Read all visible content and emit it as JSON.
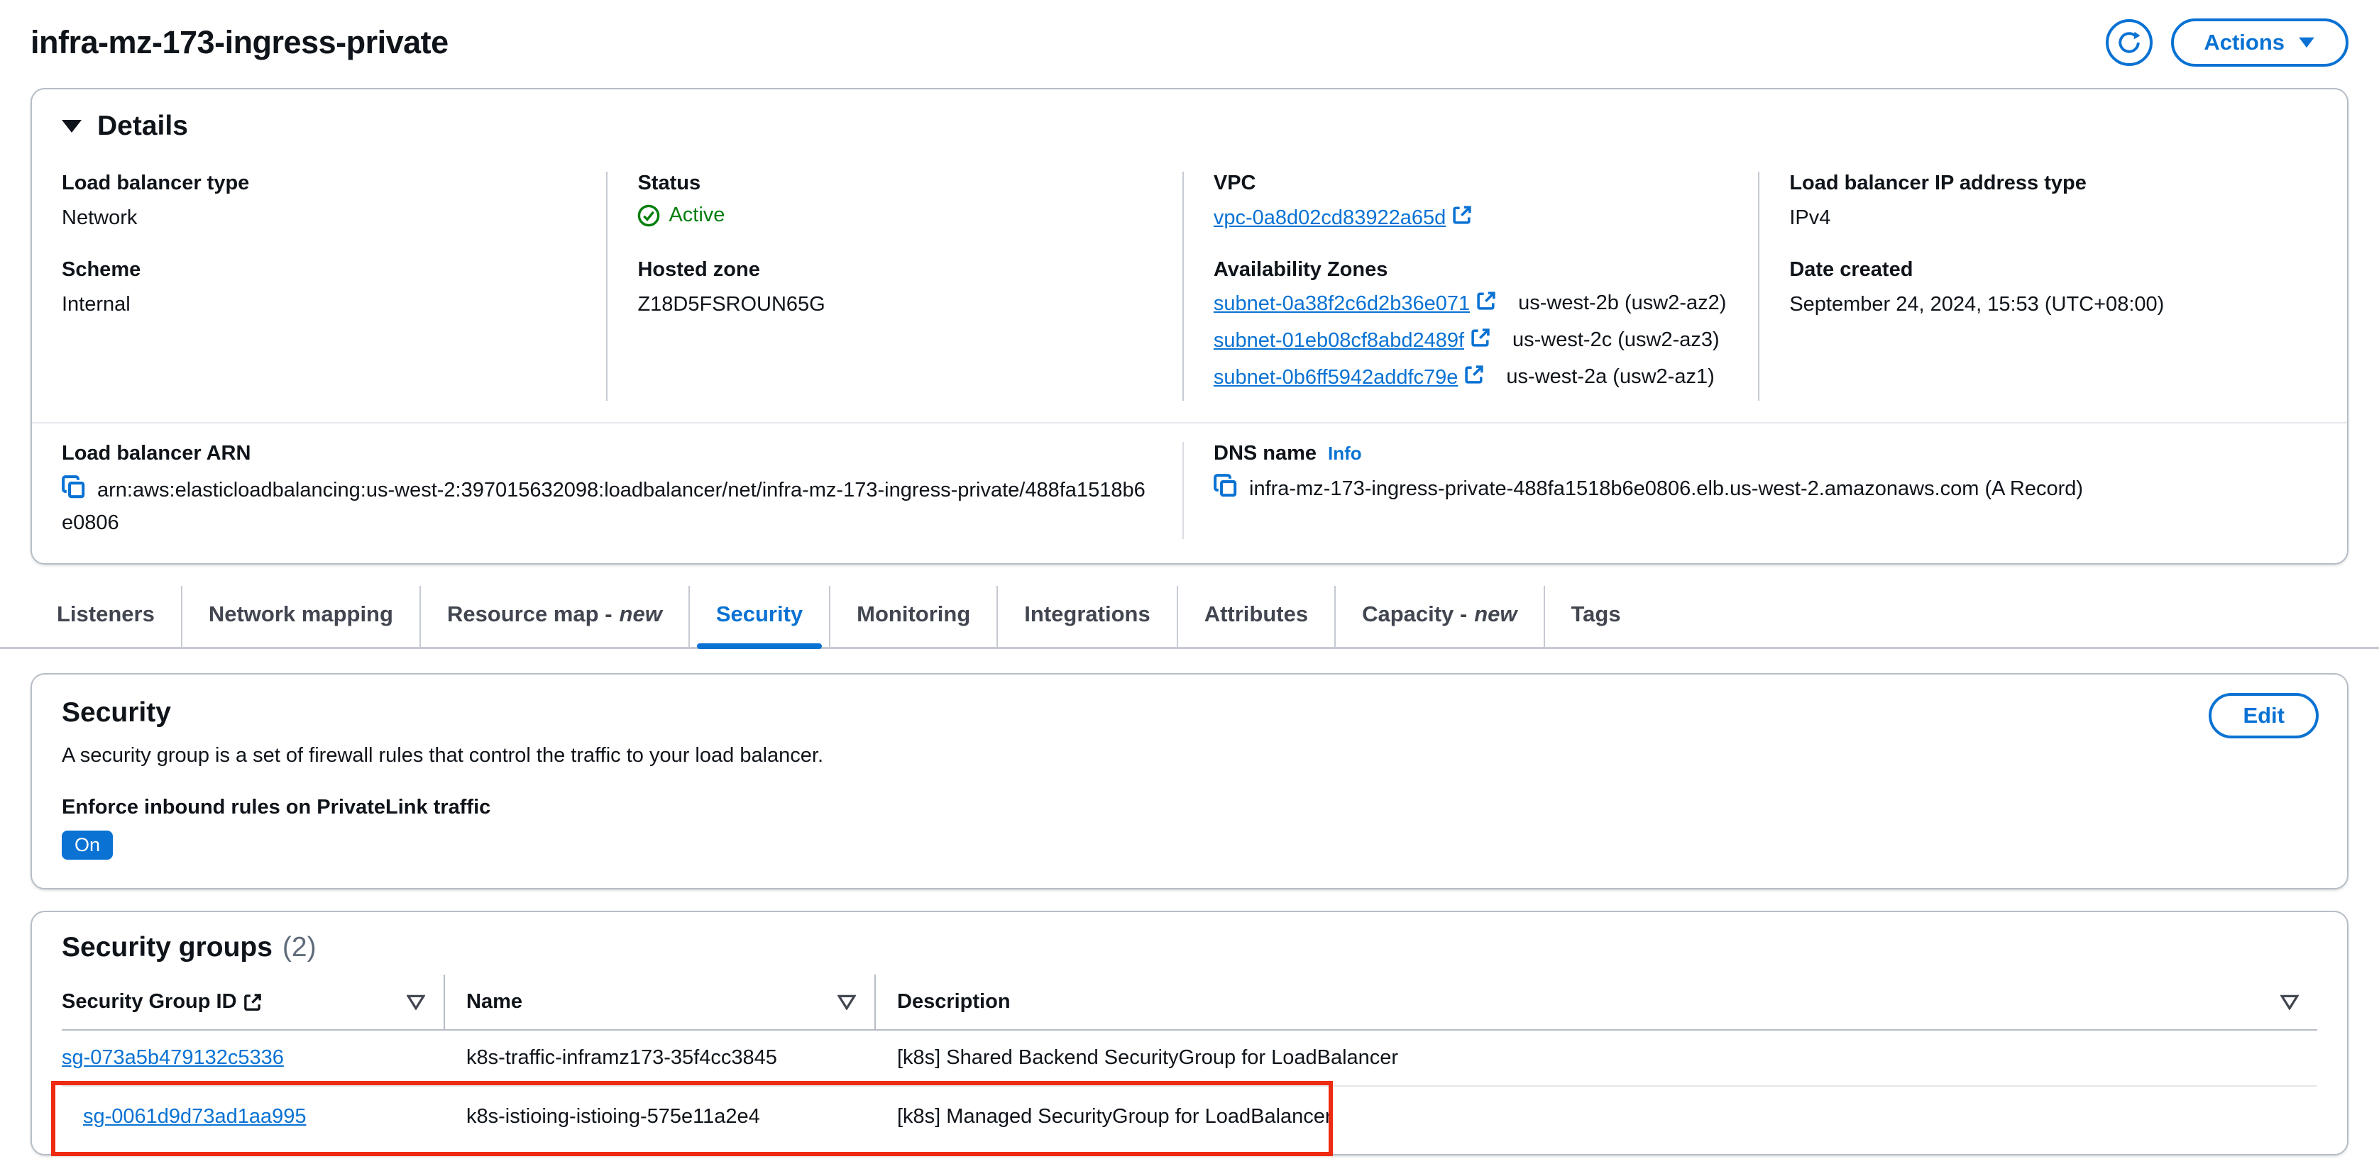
{
  "page": {
    "title": "infra-mz-173-ingress-private"
  },
  "header": {
    "actions_label": "Actions"
  },
  "colors": {
    "accent_blue": "#0972d3",
    "status_green": "#037f0c",
    "annotation_red": "#ee2b10",
    "badge_bg": "#0972d3"
  },
  "details": {
    "title": "Details",
    "load_balancer_type": {
      "label": "Load balancer type",
      "value": "Network"
    },
    "scheme": {
      "label": "Scheme",
      "value": "Internal"
    },
    "status": {
      "label": "Status",
      "value": "Active"
    },
    "hosted_zone": {
      "label": "Hosted zone",
      "value": "Z18D5FSROUN65G"
    },
    "vpc": {
      "label": "VPC",
      "link": "vpc-0a8d02cd83922a65d"
    },
    "availability_zones": {
      "label": "Availability Zones",
      "items": [
        {
          "subnet": "subnet-0a38f2c6d2b36e071",
          "zone": "us-west-2b (usw2-az2)"
        },
        {
          "subnet": "subnet-01eb08cf8abd2489f",
          "zone": "us-west-2c (usw2-az3)"
        },
        {
          "subnet": "subnet-0b6ff5942addfc79e",
          "zone": "us-west-2a (usw2-az1)"
        }
      ]
    },
    "ip_address_type": {
      "label": "Load balancer IP address type",
      "value": "IPv4"
    },
    "date_created": {
      "label": "Date created",
      "value": "September 24, 2024, 15:53 (UTC+08:00)"
    },
    "arn": {
      "label": "Load balancer ARN",
      "value": "arn:aws:elasticloadbalancing:us-west-2:397015632098:loadbalancer/net/infra-mz-173-ingress-private/488fa1518b6e0806"
    },
    "dns": {
      "label": "DNS name",
      "info_label": "Info",
      "value": "infra-mz-173-ingress-private-488fa1518b6e0806.elb.us-west-2.amazonaws.com (A Record)"
    }
  },
  "tabs": {
    "items": [
      {
        "label": "Listeners"
      },
      {
        "label": "Network mapping"
      },
      {
        "label": "Resource map -",
        "suffix": "new"
      },
      {
        "label": "Security"
      },
      {
        "label": "Monitoring"
      },
      {
        "label": "Integrations"
      },
      {
        "label": "Attributes"
      },
      {
        "label": "Capacity -",
        "suffix": "new"
      },
      {
        "label": "Tags"
      }
    ],
    "active": "Security"
  },
  "security": {
    "title": "Security",
    "edit_label": "Edit",
    "description": "A security group is a set of firewall rules that control the traffic to your load balancer.",
    "privatelink_label": "Enforce inbound rules on PrivateLink traffic",
    "privatelink_value": "On"
  },
  "security_groups": {
    "title": "Security groups",
    "count": "(2)",
    "columns": [
      {
        "label": "Security Group ID"
      },
      {
        "label": "Name"
      },
      {
        "label": "Description"
      }
    ],
    "rows": [
      {
        "id": "sg-073a5b479132c5336",
        "name": "k8s-traffic-inframz173-35f4cc3845",
        "description": "[k8s] Shared Backend SecurityGroup for LoadBalancer"
      },
      {
        "id": "sg-0061d9d73ad1aa995",
        "name": "k8s-istioing-istioing-575e11a2e4",
        "description": "[k8s] Managed SecurityGroup for LoadBalancer"
      }
    ]
  }
}
